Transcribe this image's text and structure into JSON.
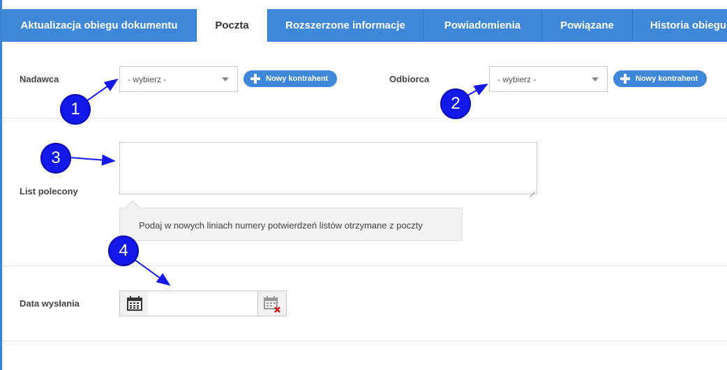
{
  "tabs": [
    {
      "label": "Aktualizacja obiegu dokumentu"
    },
    {
      "label": "Poczta"
    },
    {
      "label": "Rozszerzone informacje"
    },
    {
      "label": "Powiadomienia"
    },
    {
      "label": "Powiązane"
    },
    {
      "label": "Historia obiegu"
    }
  ],
  "form": {
    "nadawca": {
      "label": "Nadawca",
      "select_value": "- wybierz -",
      "button": "Nowy kontrahent"
    },
    "odbiorca": {
      "label": "Odbiorca",
      "select_value": "- wybierz -",
      "button": "Nowy kontrahent"
    },
    "list_polecony": {
      "label": "List polecony",
      "hint": "Podaj w nowych liniach numery potwierdzeń listów otrzymane z poczty"
    },
    "data_wyslania": {
      "label": "Data wysłania",
      "value": ""
    }
  },
  "annotations": [
    "1",
    "2",
    "3",
    "4"
  ],
  "colors": {
    "accent": "#3f87d8",
    "annotation": "#1418e8",
    "clear_x": "#d0181a"
  }
}
